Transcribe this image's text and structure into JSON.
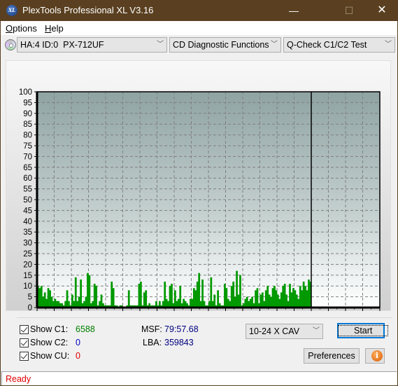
{
  "window": {
    "title": "PlexTools Professional XL V3.16",
    "app_icon": "xl-logo-icon",
    "controls": {
      "minimize": "—",
      "maximize": "☐",
      "close": "✕"
    }
  },
  "menu": {
    "items": [
      {
        "label": "Options",
        "mnemonic": "O"
      },
      {
        "label": "Help",
        "mnemonic": "H"
      }
    ]
  },
  "toolbar": {
    "drive_icon": "cd-drive-icon",
    "drive_select": "HA:4 ID:0  PX-712UF",
    "function_select": "CD Diagnostic Functions",
    "test_select": "Q-Check C1/C2 Test"
  },
  "chart_data": {
    "type": "bar",
    "title": "",
    "xlabel": "",
    "ylabel": "",
    "xlim": [
      0,
      100
    ],
    "ylim": [
      0,
      100
    ],
    "x_ticks": [
      0,
      5,
      10,
      15,
      20,
      25,
      30,
      35,
      40,
      45,
      50,
      55,
      60,
      65,
      70,
      75,
      80,
      85,
      90,
      95,
      100
    ],
    "y_ticks": [
      0,
      5,
      10,
      15,
      20,
      25,
      30,
      35,
      40,
      45,
      50,
      55,
      60,
      65,
      70,
      75,
      80,
      85,
      90,
      95,
      100
    ],
    "grid": true,
    "data_end_x": 80,
    "series": [
      {
        "name": "C1",
        "color": "#009900",
        "x_step": 0.5,
        "values": [
          10,
          9,
          10,
          5,
          7,
          4,
          9,
          8,
          5,
          3,
          4,
          3,
          3,
          2,
          2,
          1,
          3,
          8,
          3,
          1,
          6,
          3,
          14,
          3,
          5,
          13,
          2,
          3,
          5,
          16,
          15,
          2,
          3,
          11,
          10,
          1,
          3,
          6,
          2,
          1,
          1,
          1,
          1,
          12,
          9,
          1,
          1,
          0,
          1,
          1,
          0,
          0,
          1,
          8,
          1,
          1,
          1,
          1,
          1,
          11,
          12,
          1,
          7,
          8,
          1,
          2,
          1,
          1,
          1,
          3,
          1,
          3,
          1,
          3,
          12,
          4,
          3,
          10,
          11,
          2,
          8,
          3,
          4,
          10,
          2,
          4,
          3,
          2,
          1,
          4,
          4,
          9,
          8,
          12,
          16,
          3,
          13,
          3,
          1,
          1,
          3,
          14,
          3,
          6,
          1,
          8,
          2,
          1,
          1,
          11,
          9,
          4,
          3,
          10,
          12,
          5,
          17,
          6,
          15,
          1,
          2,
          4,
          5,
          3,
          4,
          5,
          2,
          8,
          9,
          2,
          6,
          7,
          3,
          8,
          10,
          6,
          5,
          9,
          10,
          8,
          6,
          4,
          7,
          10,
          11,
          6,
          3,
          11,
          7,
          9,
          8,
          6,
          4,
          10,
          8,
          12,
          10,
          8,
          13,
          12
        ]
      },
      {
        "name": "C2",
        "color": "#0000ff",
        "values": []
      },
      {
        "name": "CU",
        "color": "#ff0000",
        "values": []
      }
    ]
  },
  "results": {
    "show_c1": {
      "label": "Show C1:",
      "checked": true,
      "value": "6588",
      "color": "#008000"
    },
    "show_c2": {
      "label": "Show C2:",
      "checked": true,
      "value": "0",
      "color": "#0000c0"
    },
    "show_cu": {
      "label": "Show CU:",
      "checked": true,
      "value": "0",
      "color": "#e00000"
    },
    "msf": {
      "label": "MSF:",
      "value": "79:57.68"
    },
    "lba": {
      "label": "LBA:",
      "value": "359843"
    }
  },
  "controls": {
    "speed_select": "10-24 X CAV",
    "start_label": "Start",
    "preferences_label": "Preferences",
    "info_icon": "info-icon"
  },
  "status": {
    "text": "Ready"
  }
}
